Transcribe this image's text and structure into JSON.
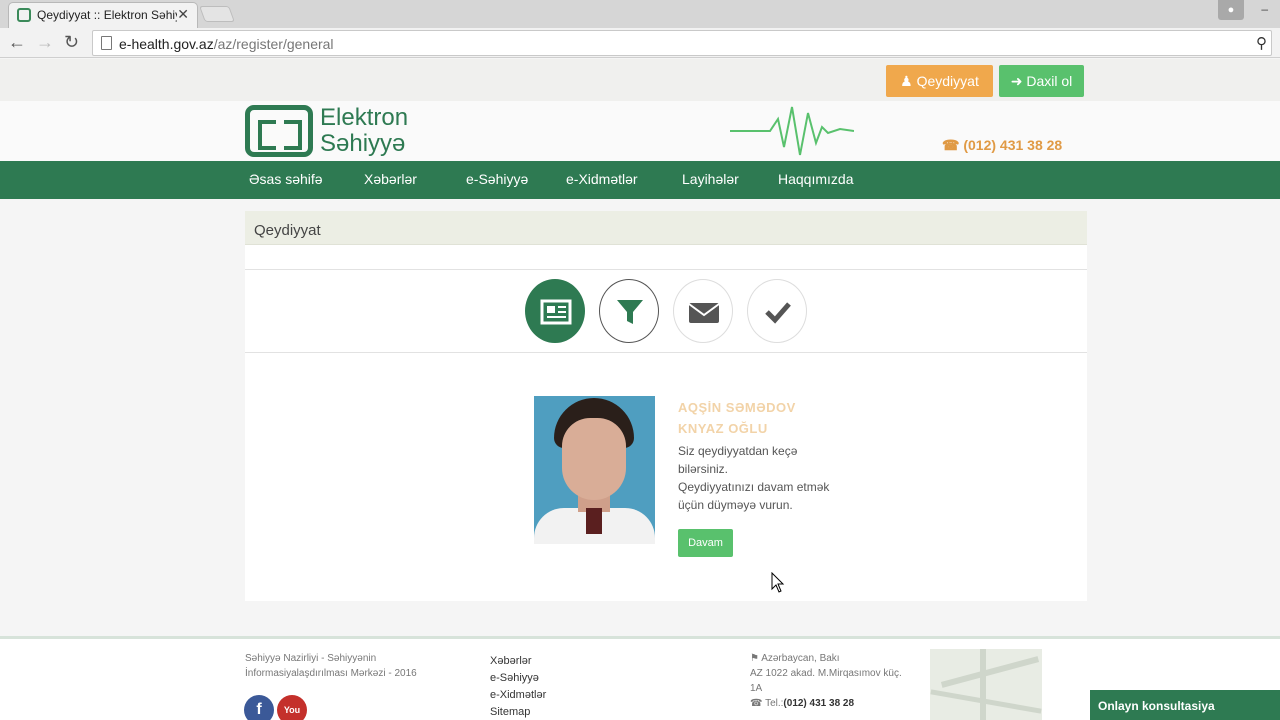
{
  "browser": {
    "tab_title": "Qeydiyyat :: Elektron Səhiyyə",
    "tab_close": "✕",
    "url_host": "e-health.gov.az",
    "url_path": "/az/register/general"
  },
  "top": {
    "register_label": "Qeydiyyat",
    "login_label": "Daxil ol"
  },
  "header": {
    "logo_line1": "Elektron",
    "logo_line2": "Səhiyyə",
    "phone": "(012) 431 38 28"
  },
  "nav": {
    "items": [
      "Əsas səhifə",
      "Xəbərlər",
      "e-Səhiyyə",
      "e-Xidmətlər",
      "Layihələr",
      "Haqqımızda"
    ]
  },
  "content": {
    "title": "Qeydiyyat",
    "steps": [
      {
        "icon": "newspaper-icon",
        "state": "active"
      },
      {
        "icon": "filter-icon",
        "state": "current"
      },
      {
        "icon": "envelope-icon",
        "state": "pending"
      },
      {
        "icon": "check-icon",
        "state": "pending"
      }
    ],
    "person_name_line1": "AQŞİN SƏMƏDOV",
    "person_name_line2": "KNYAZ OĞLU",
    "message_line1": "Siz qeydiyyatdan keçə",
    "message_line2": "bilərsiniz.",
    "message_line3": "Qeydiyyatınızı davam etmək",
    "message_line4": "üçün düyməyə vurun.",
    "continue_label": "Davam"
  },
  "footer": {
    "org_line1": "Səhiyyə Nazirliyi - Səhiyyənin",
    "org_line2": "İnformasiyalaşdırılması Mərkəzi - 2016",
    "links": [
      "Xəbərlər",
      "e-Səhiyyə",
      "e-Xidmətlər",
      "Sitemap"
    ],
    "addr_line1": "Azərbaycan, Bakı",
    "addr_line2": "AZ 1022 akad. M.Mirqasımov küç.",
    "addr_line3": "1A",
    "tel_label": "Tel.:",
    "tel_value": "(012) 431 38 28",
    "consult_label": "Onlayn konsultasiya"
  },
  "colors": {
    "brand_green": "#2e7a52",
    "button_orange": "#f0a84c",
    "button_green": "#59c16d",
    "phone_orange": "#e09a45"
  }
}
